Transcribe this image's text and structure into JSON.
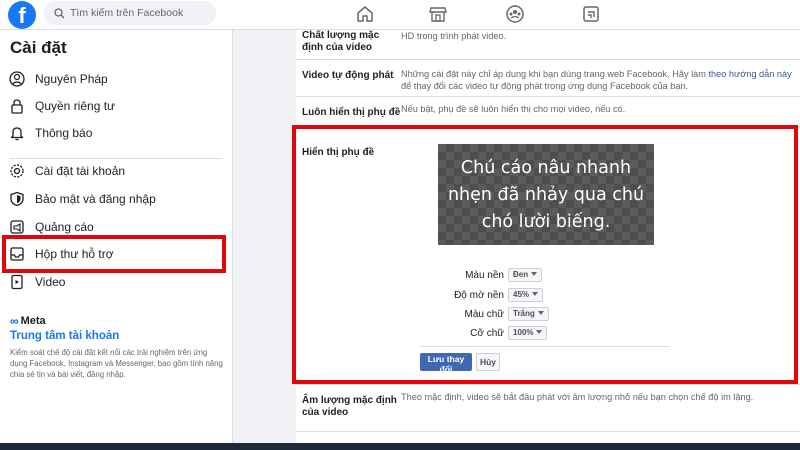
{
  "topbar": {
    "logo": "f",
    "search_placeholder": "Tìm kiếm trên Facebook",
    "nav_icons": [
      "home-icon",
      "marketplace-icon",
      "groups-icon",
      "gaming-icon"
    ]
  },
  "sidebar": {
    "title": "Cài đặt",
    "items": [
      {
        "label": "Nguyên Pháp",
        "icon": "profile-icon"
      },
      {
        "label": "Quyền riêng tư",
        "icon": "lock-icon"
      },
      {
        "label": "Thông báo",
        "icon": "bell-icon"
      },
      {
        "label": "Cài đặt tài khoản",
        "icon": "gear-icon"
      },
      {
        "label": "Bảo mật và đăng nhập",
        "icon": "shield-icon"
      },
      {
        "label": "Quảng cáo",
        "icon": "megaphone-icon"
      },
      {
        "label": "Hộp thư hỗ trợ",
        "icon": "inbox-icon"
      },
      {
        "label": "Video",
        "icon": "video-icon",
        "selected": true
      }
    ],
    "meta_label": "Meta",
    "account_center": "Trung tâm tài khoản",
    "account_desc": "Kiểm soát chế độ cài đặt kết nối các trải nghiệm trên ứng dụng Facebook, Instagram và Messenger, bao gồm tính năng chia sẻ tin và bài viết, đăng nhập."
  },
  "main": {
    "rows": [
      {
        "label": "Chất lượng mặc định của video",
        "text": "HD trong trình phát video."
      },
      {
        "label": "Video tự động phát",
        "text": "Những cài đặt này chỉ áp dụng khi bạn dùng trang web Facebook. Hãy làm",
        "link": "theo hướng dẫn này",
        "text2": "để thay đổi các video tự động phát trong ứng dụng Facebook của bạn."
      },
      {
        "label": "Luôn hiển thị phụ đề",
        "text": "Nếu bật, phụ đề sẽ luôn hiển thị cho mọi video, nếu có."
      },
      {
        "label": "Âm lượng mặc định của video",
        "text": "Theo mặc định, video sẽ bắt đầu phát với âm lượng nhỏ nếu bạn chọn chế độ im lặng."
      }
    ],
    "captions": {
      "label": "Hiển thị phụ đề",
      "preview_text": "Chú cáo nâu nhanh nhẹn đã nhảy qua chú chó lười biếng.",
      "options": [
        {
          "label": "Màu nền",
          "value": "Đen"
        },
        {
          "label": "Độ mờ nền",
          "value": "45%"
        },
        {
          "label": "Màu chữ",
          "value": "Trắng"
        },
        {
          "label": "Cỡ chữ",
          "value": "100%"
        }
      ],
      "save_label": "Lưu thay đổi",
      "cancel_label": "Hủy"
    }
  },
  "colors": {
    "accent": "#1877f2",
    "highlight": "#e3050c",
    "button": "#4267b2"
  }
}
